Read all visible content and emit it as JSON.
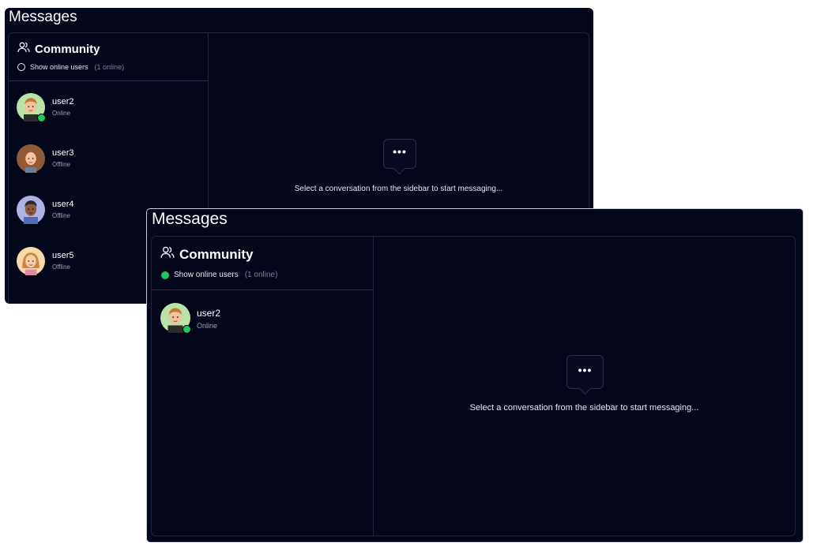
{
  "colors": {
    "background": "#04061a",
    "accent_online": "#22c55e",
    "muted": "#7d8296"
  },
  "windows": {
    "back": {
      "title": "Messages",
      "sidebar": {
        "heading": "Community",
        "heading_icon": "users-icon",
        "toggle_label": "Show online users",
        "toggle_state": "off",
        "online_count": "(1 online)",
        "users": [
          {
            "name": "user2",
            "status": "Online"
          },
          {
            "name": "user3",
            "status": "Offline"
          },
          {
            "name": "user4",
            "status": "Offline"
          },
          {
            "name": "user5",
            "status": "Offline"
          }
        ]
      },
      "main": {
        "icon": "chat-bubble-icon",
        "hint": "Select a conversation from the sidebar to start messaging..."
      }
    },
    "front": {
      "title": "Messages",
      "sidebar": {
        "heading": "Community",
        "heading_icon": "users-icon",
        "toggle_label": "Show online users",
        "toggle_state": "on",
        "online_count": "(1 online)",
        "users": [
          {
            "name": "user2",
            "status": "Online"
          }
        ]
      },
      "main": {
        "icon": "chat-bubble-icon",
        "hint": "Select a conversation from the sidebar to start messaging..."
      }
    }
  }
}
